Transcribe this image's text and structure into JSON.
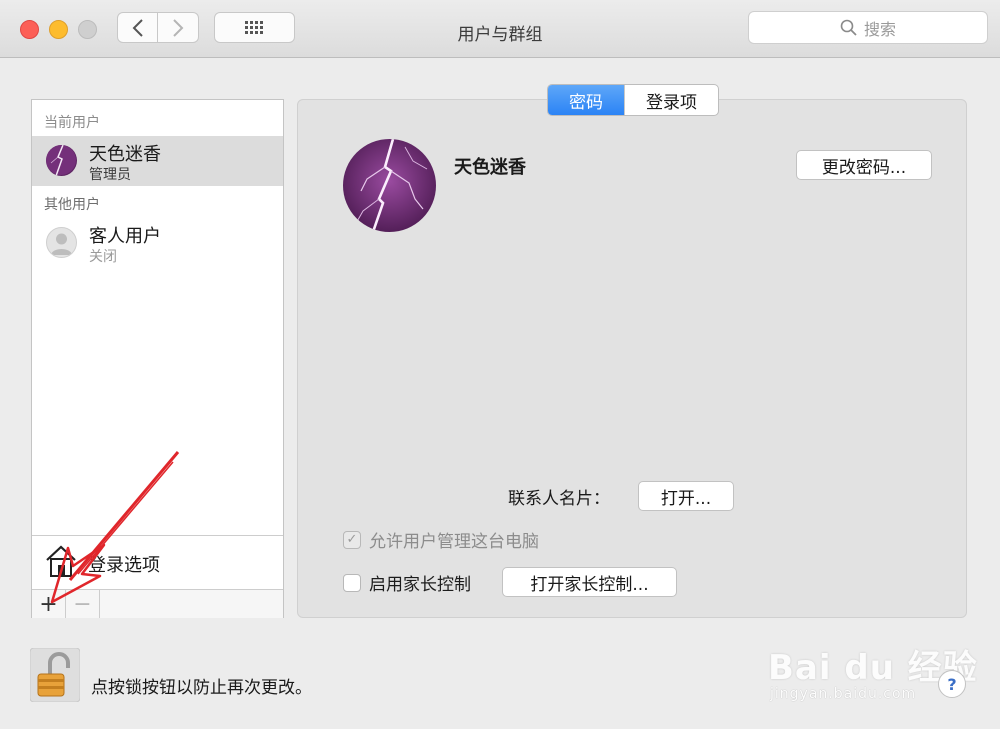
{
  "window": {
    "title": "用户与群组"
  },
  "search": {
    "placeholder": "搜索"
  },
  "sidebar": {
    "current_header": "当前用户",
    "current_user": {
      "name": "天色迷香",
      "role": "管理员"
    },
    "others_header": "其他用户",
    "guest_user": {
      "name": "客人用户",
      "status": "关闭"
    },
    "login_options": "登录选项",
    "add_label": "+",
    "remove_label": "−"
  },
  "tabs": [
    {
      "label": "密码",
      "active": true
    },
    {
      "label": "登录项",
      "active": false
    }
  ],
  "main": {
    "user_name": "天色迷香",
    "change_password": "更改密码...",
    "contact_label": "联系人名片：",
    "open_button": "打开...",
    "allow_admin": {
      "label": "允许用户管理这台电脑",
      "checked": true,
      "enabled": false
    },
    "parental": {
      "label": "启用家长控制",
      "checked": false,
      "enabled": true
    },
    "open_parental": "打开家长控制..."
  },
  "footer": {
    "lock_text": "点按锁按钮以防止再次更改。",
    "help": "?"
  },
  "watermark": {
    "brand": "Bai du 经验",
    "url": "jingyan.baidu.com"
  },
  "colors": {
    "accent": "#2b83f5",
    "selection": "#dcdcdc",
    "avatar": "#6b2a6e",
    "annotation_arrow": "#e0262b"
  },
  "icons": [
    "chevron-left-icon",
    "chevron-right-icon",
    "grid-icon",
    "search-icon",
    "house-icon",
    "person-icon",
    "lock-icon",
    "help-icon"
  ]
}
